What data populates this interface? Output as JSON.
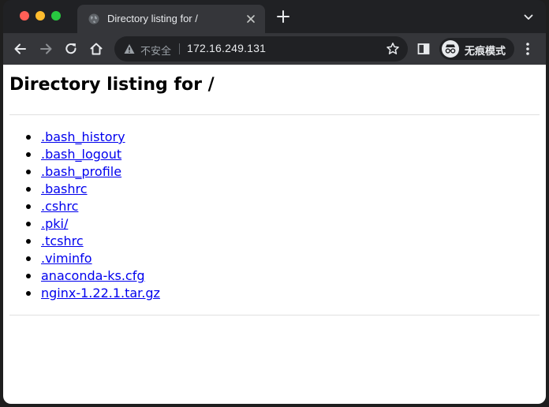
{
  "browser": {
    "tab": {
      "title": "Directory listing for /",
      "favicon": "globe-icon",
      "close_icon": "close-icon"
    },
    "new_tab_icon": "plus-icon",
    "tab_search_icon": "chevron-down-icon",
    "toolbar": {
      "back_icon": "back-arrow-icon",
      "forward_icon": "forward-arrow-icon",
      "reload_icon": "reload-icon",
      "home_icon": "home-icon",
      "security_label": "不安全",
      "url": "172.16.249.131",
      "bookmark_icon": "star-icon",
      "side_panel_icon": "side-panel-icon",
      "incognito_label": "无痕模式",
      "menu_icon": "kebab-menu-icon"
    },
    "colors": {
      "chrome_dark": "#202124",
      "toolbar": "#35363a",
      "link": "#0000ee"
    }
  },
  "page": {
    "heading": "Directory listing for /",
    "entries": [
      ".bash_history",
      ".bash_logout",
      ".bash_profile",
      ".bashrc",
      ".cshrc",
      ".pki/",
      ".tcshrc",
      ".viminfo",
      "anaconda-ks.cfg",
      "nginx-1.22.1.tar.gz"
    ]
  }
}
